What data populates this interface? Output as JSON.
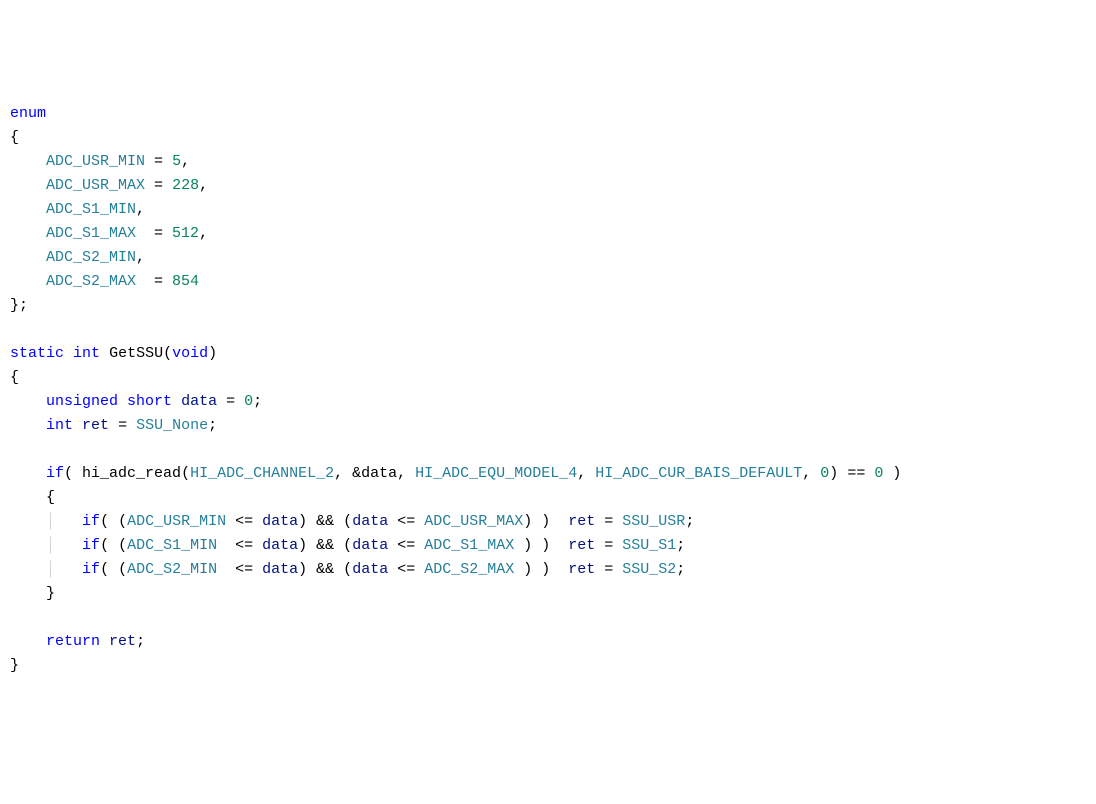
{
  "code": {
    "kw_enum": "enum",
    "open_brace": "{",
    "enum1_id": "ADC_USR_MIN",
    "enum1_eq": " = ",
    "enum1_val": "5",
    "comma": ",",
    "enum2_id": "ADC_USR_MAX",
    "enum2_val": "228",
    "enum3_id": "ADC_S1_MIN",
    "enum4_id": "ADC_S1_MAX",
    "enum4_pad": "  = ",
    "enum4_val": "512",
    "enum5_id": "ADC_S2_MIN",
    "enum6_id": "ADC_S2_MAX",
    "enum6_val": "854",
    "close_enum": "};",
    "kw_static": "static",
    "kw_int": "int",
    "fn_name": "GetSSU",
    "paren_open": "(",
    "kw_void": "void",
    "paren_close": ")",
    "kw_unsigned": "unsigned",
    "kw_short": "short",
    "var_data": "data",
    "eq": " = ",
    "zero": "0",
    "semi": ";",
    "var_ret": "ret",
    "ssu_none": "SSU_None",
    "kw_if": "if",
    "fn_hi": "hi_adc_read",
    "hi_chan": "HI_ADC_CHANNEL_2",
    "amp_data": "&data",
    "hi_equ": "HI_ADC_EQU_MODEL_4",
    "hi_bais": "HI_ADC_CUR_BAIS_DEFAULT",
    "cmp_eq0": " == ",
    "zero2": "0",
    "usr_min": "ADC_USR_MIN",
    "le": " <= ",
    "and": " && ",
    "usr_max": "ADC_USR_MAX",
    "ssu_usr": "SSU_USR",
    "s1_min": "ADC_S1_MIN",
    "s1_max": "ADC_S1_MAX",
    "ssu_s1": "SSU_S1",
    "s2_min": "ADC_S2_MIN",
    "s2_max": "ADC_S2_MAX",
    "ssu_s2": "SSU_S2",
    "kw_return": "return",
    "close_brace": "}"
  }
}
